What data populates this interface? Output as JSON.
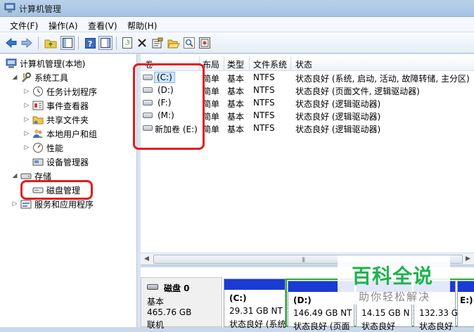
{
  "window": {
    "title": "计算机管理"
  },
  "menu": [
    "文件(F)",
    "操作(A)",
    "查看(V)",
    "帮助(H)"
  ],
  "toolbar_icons": [
    "back-arrow-icon",
    "forward-arrow-icon",
    "up-folder-icon",
    "show-tree-icon",
    "help-icon",
    "action-pane-icon",
    "refresh-icon",
    "delete-icon",
    "properties-icon",
    "open-folder-icon",
    "search-icon",
    "export-icon"
  ],
  "tree": {
    "root": "计算机管理(本地)",
    "items": [
      {
        "label": "系统工具",
        "level": 1,
        "arrow": "◢",
        "icon": "tools-icon"
      },
      {
        "label": "任务计划程序",
        "level": 2,
        "arrow": "▷",
        "icon": "clock-icon"
      },
      {
        "label": "事件查看器",
        "level": 2,
        "arrow": "▷",
        "icon": "event-viewer-icon"
      },
      {
        "label": "共享文件夹",
        "level": 2,
        "arrow": "▷",
        "icon": "shared-folder-icon"
      },
      {
        "label": "本地用户和组",
        "level": 2,
        "arrow": "▷",
        "icon": "users-icon"
      },
      {
        "label": "性能",
        "level": 2,
        "arrow": "▷",
        "icon": "performance-icon"
      },
      {
        "label": "设备管理器",
        "level": 2,
        "arrow": "",
        "icon": "device-manager-icon"
      },
      {
        "label": "存储",
        "level": 1,
        "arrow": "◢",
        "icon": "storage-icon"
      },
      {
        "label": "磁盘管理",
        "level": 2,
        "arrow": "",
        "icon": "disk-management-icon"
      },
      {
        "label": "服务和应用程序",
        "level": 1,
        "arrow": "▷",
        "icon": "services-icon"
      }
    ]
  },
  "volumes": {
    "columns": [
      "卷",
      "布局",
      "类型",
      "文件系统",
      "状态"
    ],
    "rows": [
      {
        "name": "(C:)",
        "layout": "简单",
        "type": "基本",
        "fs": "NTFS",
        "status": "状态良好 (系统, 启动, 活动, 故障转储, 主分区)"
      },
      {
        "name": "(D:)",
        "layout": "简单",
        "type": "基本",
        "fs": "NTFS",
        "status": "状态良好 (页面文件, 逻辑驱动器)"
      },
      {
        "name": "(F:)",
        "layout": "简单",
        "type": "基本",
        "fs": "NTFS",
        "status": "状态良好 (逻辑驱动器)"
      },
      {
        "name": "(M:)",
        "layout": "简单",
        "type": "基本",
        "fs": "NTFS",
        "status": "状态良好 (逻辑驱动器)"
      },
      {
        "name": "新加卷 (E:)",
        "layout": "简单",
        "type": "基本",
        "fs": "NTFS",
        "status": "状态良好 (逻辑驱动器)"
      }
    ]
  },
  "disk": {
    "title": "磁盘 0",
    "kind": "基本",
    "size": "465.76 GB",
    "state": "联机",
    "partitions": [
      {
        "label": "(C:)",
        "size": "29.31 GB NT",
        "status": "状态良好 (系统"
      },
      {
        "label": "(D:)",
        "size": "146.49 GB NT",
        "status": "状态良好 (页面"
      },
      {
        "label": "",
        "size": "14.15 GB N",
        "status": "状态良好"
      },
      {
        "label": "",
        "size": "132.33 GB N",
        "status": "状态良好"
      },
      {
        "label": "E:)",
        "size": "",
        "status": ""
      }
    ]
  },
  "watermark": {
    "main": "百科全说",
    "sub": "助你轻松解决"
  },
  "colors": {
    "accent_red": "#e41c1c",
    "partition_bar": "#1a3bd4",
    "watermark_green": "#1db34c"
  }
}
